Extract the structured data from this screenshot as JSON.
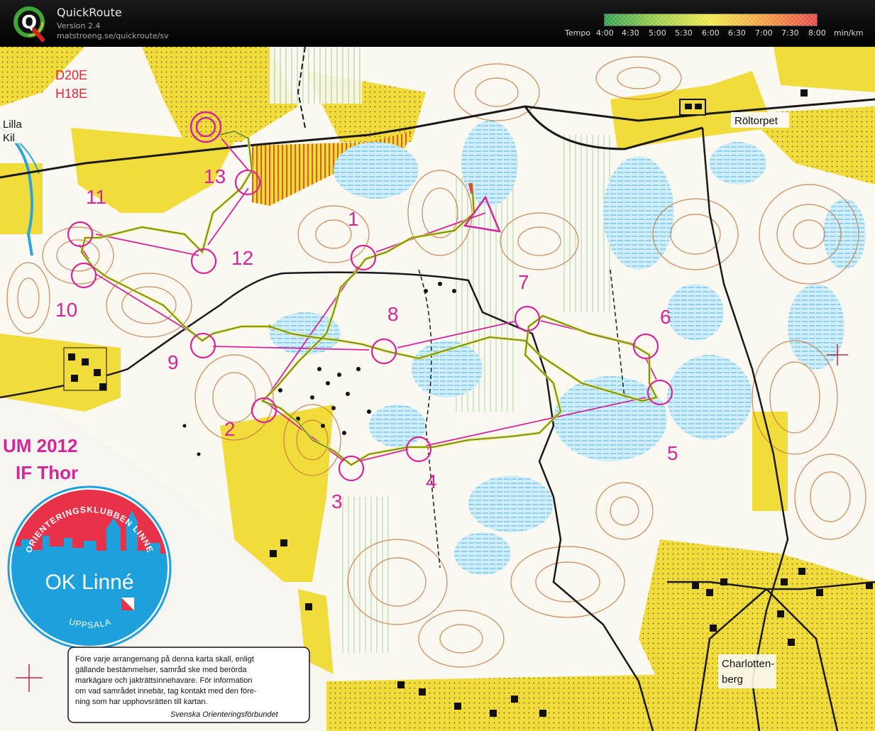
{
  "app": {
    "title": "QuickRoute",
    "version": "Version 2.4",
    "url": "matstroeng.se/quickroute/sv"
  },
  "tempo": {
    "label": "Tempo",
    "ticks": [
      "4:00",
      "4:30",
      "5:00",
      "5:30",
      "6:00",
      "6:30",
      "7:00",
      "7:30",
      "8:00"
    ],
    "unit": "min/km",
    "colors": [
      "#2e9e4a",
      "#6fbd4b",
      "#b8d64a",
      "#f0e84a",
      "#f6c443",
      "#f29b3f",
      "#ec6d3f",
      "#e64646"
    ]
  },
  "map": {
    "class_labels": [
      "D20E",
      "H18E"
    ],
    "place_names": {
      "lilla": "Lilla",
      "kil": "Kil",
      "roltorpet": "Röltorpet",
      "charlotten": "Charlotten-",
      "berg": "berg"
    },
    "event_title": "UM 2012",
    "event_club": "IF Thor",
    "controls": [
      "1",
      "2",
      "3",
      "4",
      "5",
      "6",
      "7",
      "8",
      "9",
      "10",
      "11",
      "12",
      "13"
    ],
    "notice": {
      "lines": [
        "Före varje arrangemang på denna karta skall, enligt",
        "gällande bestämmelser, samråd ske med berörda",
        "markägare och jakträttsinnehavare. För information",
        "om vad samrådet innebär, tag kontakt med den före-",
        "ning som har upphovsrätten till kartan."
      ],
      "signature": "Svenska Orienteringsförbundet"
    },
    "club_logo": {
      "top_text": "ORIENTERINGSKLUBBEN LINNE",
      "name": "OK Linné",
      "bottom_text": "UPPSALA"
    },
    "colors": {
      "course": "#d6249a",
      "route": "#6d8a2a",
      "open_land": "#f2dc3c",
      "forest": "#fbf8f1",
      "water": "#bfe6f5",
      "contour": "#c4753a",
      "track": "#1a1a1a"
    }
  }
}
